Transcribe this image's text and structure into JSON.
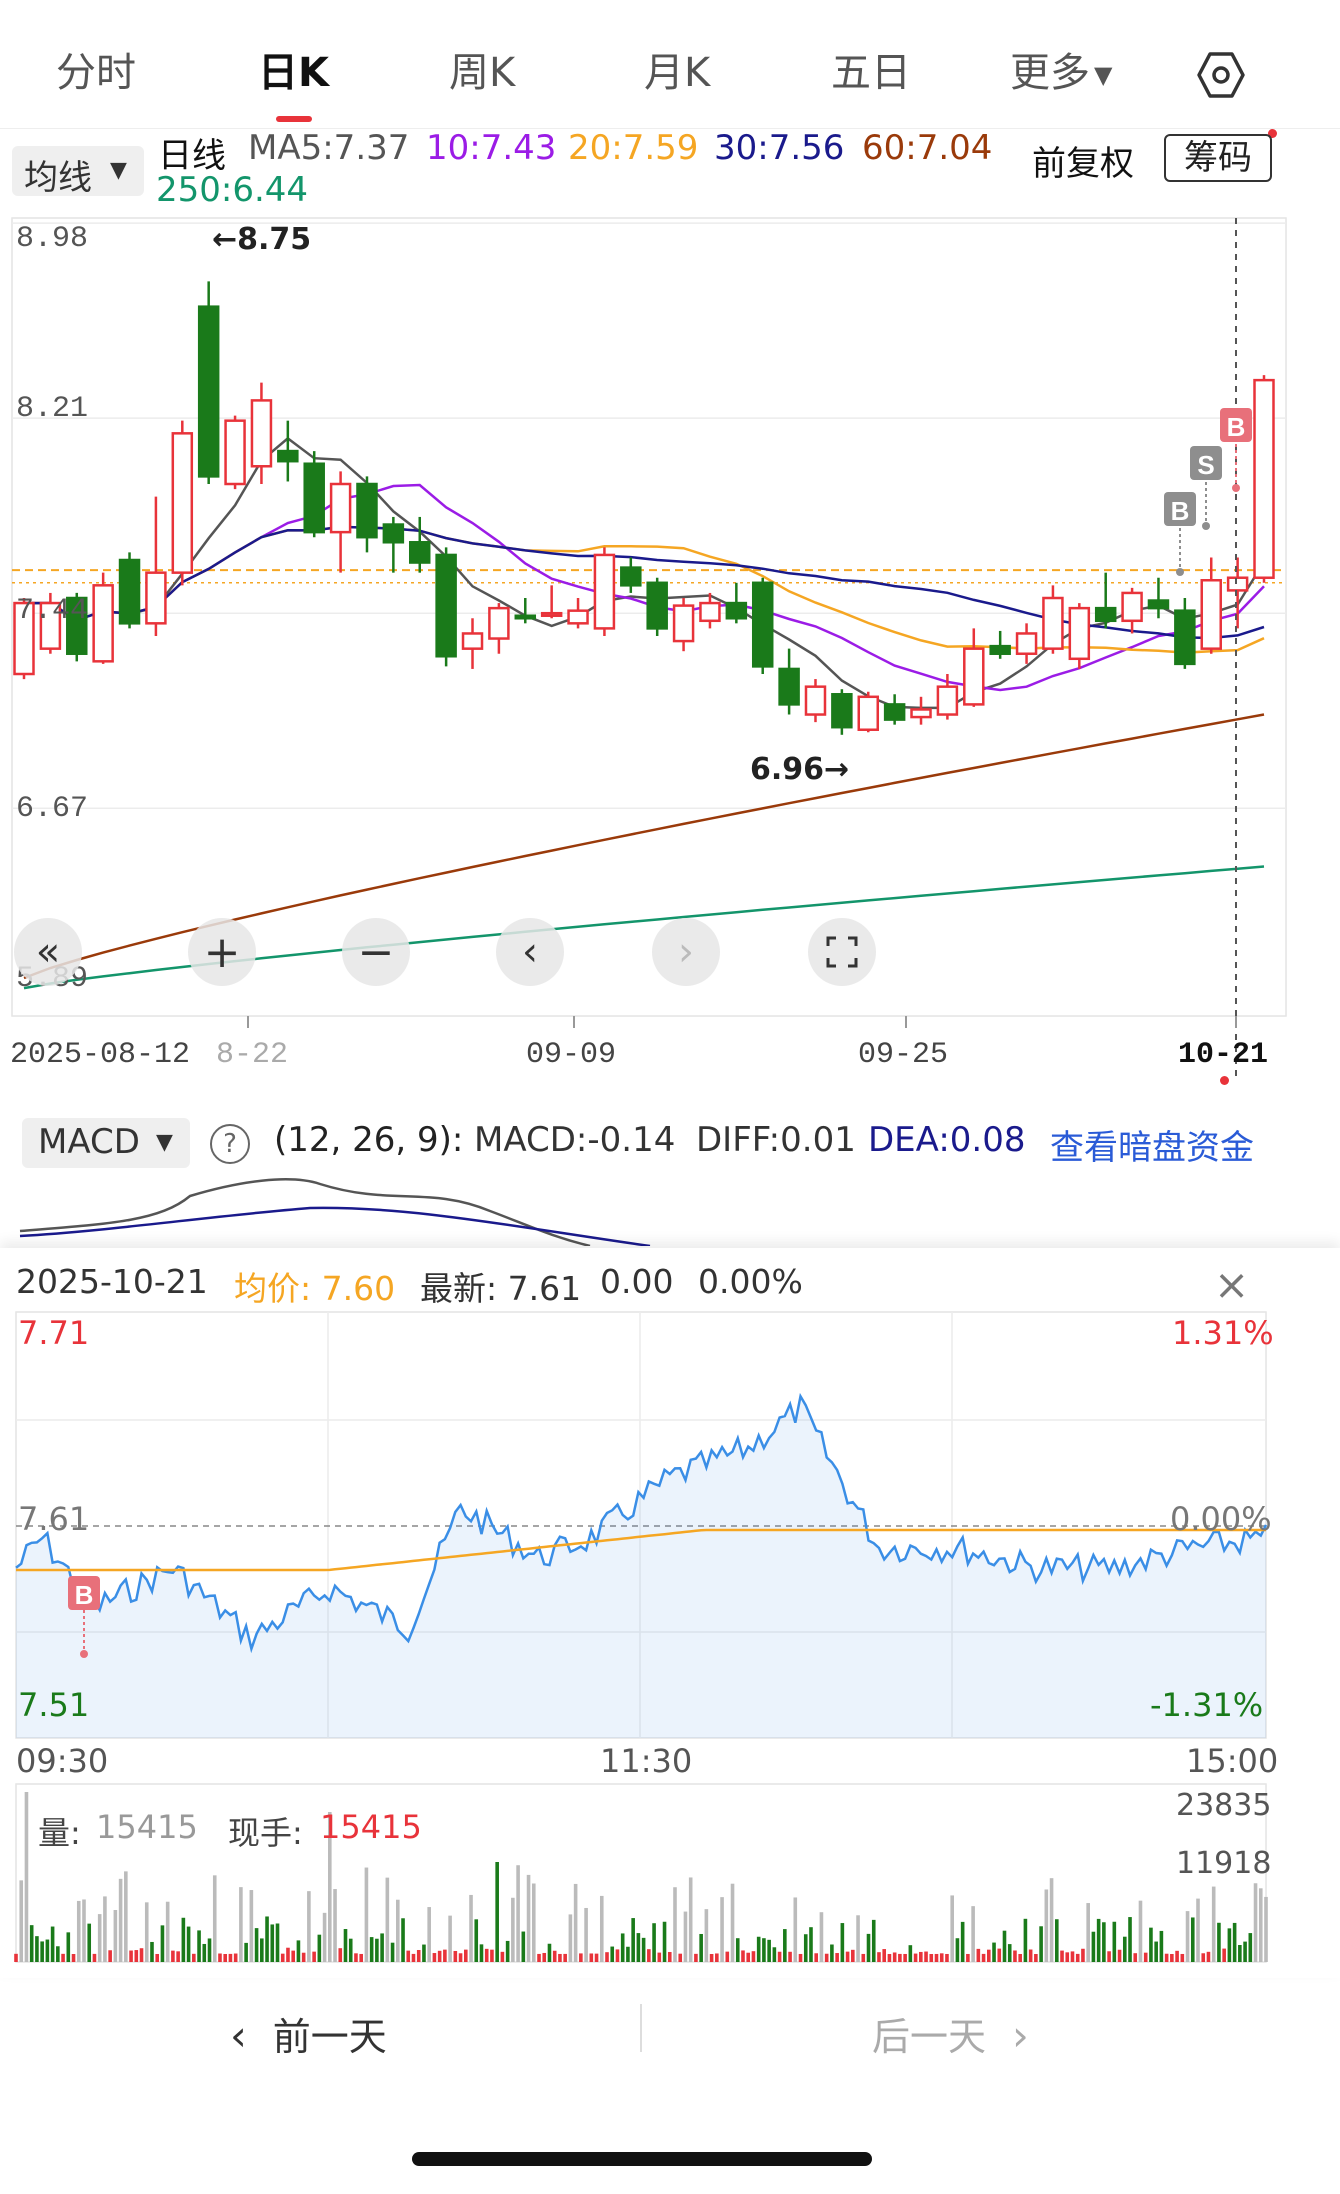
{
  "tabs": [
    "分时",
    "日K",
    "周K",
    "月K",
    "五日",
    "更多"
  ],
  "active_tab": 1,
  "ma_bar": {
    "selector_label": "均线",
    "period_label": "日线",
    "ma5": "MA5:7.37",
    "ma10": "10:7.43",
    "ma20": "20:7.59",
    "ma30": "30:7.56",
    "ma60": "60:7.04",
    "ma250": "250:6.44",
    "fq_label": "前复权",
    "chip_label": "筹码"
  },
  "colors": {
    "up": "#e8333a",
    "down": "#1a7a1a",
    "ma5": "#555555",
    "ma10": "#9b1ce6",
    "ma20": "#f5a623",
    "ma30": "#1a1a8c",
    "ma60": "#9a3a0a",
    "ma250": "#13956b",
    "price_line": "#3a8ee6",
    "avg_line": "#f5a623"
  },
  "kline": {
    "y_labels": [
      "8.98",
      "8.21",
      "7.44",
      "6.67",
      "5.89"
    ],
    "x_labels": [
      "2025-08-12",
      "8-22",
      "09-09",
      "09-25",
      "10-21"
    ],
    "high_marker": "←8.75",
    "low_marker": "6.96→",
    "signals": [
      "B",
      "S",
      "B"
    ],
    "candles": [
      {
        "o": 7.2,
        "c": 7.48,
        "h": 7.5,
        "l": 7.18
      },
      {
        "o": 7.3,
        "c": 7.48,
        "h": 7.52,
        "l": 7.28
      },
      {
        "o": 7.5,
        "c": 7.28,
        "h": 7.52,
        "l": 7.25
      },
      {
        "o": 7.25,
        "c": 7.55,
        "h": 7.6,
        "l": 7.24
      },
      {
        "o": 7.65,
        "c": 7.4,
        "h": 7.68,
        "l": 7.38
      },
      {
        "o": 7.4,
        "c": 7.6,
        "h": 7.9,
        "l": 7.35
      },
      {
        "o": 7.6,
        "c": 8.15,
        "h": 8.2,
        "l": 7.55
      },
      {
        "o": 8.65,
        "c": 7.98,
        "h": 8.75,
        "l": 7.95
      },
      {
        "o": 7.95,
        "c": 8.2,
        "h": 8.22,
        "l": 7.93
      },
      {
        "o": 8.02,
        "c": 8.28,
        "h": 8.35,
        "l": 7.95
      },
      {
        "o": 8.08,
        "c": 8.04,
        "h": 8.2,
        "l": 7.96
      },
      {
        "o": 8.03,
        "c": 7.76,
        "h": 8.08,
        "l": 7.74
      },
      {
        "o": 7.76,
        "c": 7.95,
        "h": 8.0,
        "l": 7.6
      },
      {
        "o": 7.95,
        "c": 7.74,
        "h": 7.98,
        "l": 7.68
      },
      {
        "o": 7.79,
        "c": 7.72,
        "h": 7.82,
        "l": 7.6
      },
      {
        "o": 7.72,
        "c": 7.64,
        "h": 7.82,
        "l": 7.6
      },
      {
        "o": 7.67,
        "c": 7.27,
        "h": 7.7,
        "l": 7.23
      },
      {
        "o": 7.3,
        "c": 7.36,
        "h": 7.42,
        "l": 7.22
      },
      {
        "o": 7.34,
        "c": 7.46,
        "h": 7.48,
        "l": 7.28
      },
      {
        "o": 7.43,
        "c": 7.42,
        "h": 7.5,
        "l": 7.4
      },
      {
        "o": 7.43,
        "c": 7.44,
        "h": 7.55,
        "l": 7.42
      },
      {
        "o": 7.4,
        "c": 7.45,
        "h": 7.5,
        "l": 7.38
      },
      {
        "o": 7.38,
        "c": 7.67,
        "h": 7.7,
        "l": 7.35
      },
      {
        "o": 7.62,
        "c": 7.55,
        "h": 7.66,
        "l": 7.52
      },
      {
        "o": 7.56,
        "c": 7.38,
        "h": 7.58,
        "l": 7.35
      },
      {
        "o": 7.33,
        "c": 7.47,
        "h": 7.5,
        "l": 7.29
      },
      {
        "o": 7.41,
        "c": 7.48,
        "h": 7.52,
        "l": 7.38
      },
      {
        "o": 7.48,
        "c": 7.42,
        "h": 7.56,
        "l": 7.4
      },
      {
        "o": 7.56,
        "c": 7.23,
        "h": 7.58,
        "l": 7.2
      },
      {
        "o": 7.22,
        "c": 7.08,
        "h": 7.3,
        "l": 7.04
      },
      {
        "o": 7.04,
        "c": 7.15,
        "h": 7.18,
        "l": 7.01
      },
      {
        "o": 7.12,
        "c": 6.99,
        "h": 7.14,
        "l": 6.96
      },
      {
        "o": 6.98,
        "c": 7.11,
        "h": 7.13,
        "l": 6.97
      },
      {
        "o": 7.08,
        "c": 7.02,
        "h": 7.12,
        "l": 7.0
      },
      {
        "o": 7.03,
        "c": 7.06,
        "h": 7.11,
        "l": 7.0
      },
      {
        "o": 7.04,
        "c": 7.15,
        "h": 7.2,
        "l": 7.02
      },
      {
        "o": 7.08,
        "c": 7.3,
        "h": 7.38,
        "l": 7.07
      },
      {
        "o": 7.31,
        "c": 7.28,
        "h": 7.37,
        "l": 7.26
      },
      {
        "o": 7.28,
        "c": 7.36,
        "h": 7.4,
        "l": 7.24
      },
      {
        "o": 7.3,
        "c": 7.5,
        "h": 7.55,
        "l": 7.28
      },
      {
        "o": 7.26,
        "c": 7.46,
        "h": 7.48,
        "l": 7.22
      },
      {
        "o": 7.46,
        "c": 7.41,
        "h": 7.6,
        "l": 7.38
      },
      {
        "o": 7.41,
        "c": 7.52,
        "h": 7.54,
        "l": 7.36
      },
      {
        "o": 7.49,
        "c": 7.46,
        "h": 7.58,
        "l": 7.42
      },
      {
        "o": 7.45,
        "c": 7.24,
        "h": 7.5,
        "l": 7.22
      },
      {
        "o": 7.3,
        "c": 7.57,
        "h": 7.66,
        "l": 7.28
      },
      {
        "o": 7.53,
        "c": 7.58,
        "h": 7.66,
        "l": 7.38
      },
      {
        "o": 7.58,
        "c": 8.36,
        "h": 8.38,
        "l": 7.56
      }
    ]
  },
  "macd": {
    "selector_label": "MACD",
    "params": "(12, 26, 9):",
    "macd_value": "MACD:-0.14",
    "diff_value": "DIFF:0.01",
    "dea_value": "DEA:0.08",
    "link_label": "查看暗盘资金"
  },
  "intraday": {
    "date": "2025-10-21",
    "avg_label": "均价: 7.60",
    "latest_label": "最新: 7.61",
    "change": "0.00",
    "change_pct": "0.00%",
    "y_top": "7.71",
    "y_mid": "7.61",
    "y_bottom": "7.51",
    "pct_top": "1.31%",
    "pct_mid": "0.00%",
    "pct_bottom": "-1.31%",
    "x_labels": [
      "09:30",
      "11:30",
      "15:00"
    ],
    "signal": "B",
    "volume_label": "量:",
    "volume_value": "15415",
    "current_label": "现手:",
    "current_value": "15415",
    "vol_top": "23835",
    "vol_mid": "11918"
  },
  "nav": {
    "prev_label": "前一天",
    "next_label": "后一天"
  }
}
